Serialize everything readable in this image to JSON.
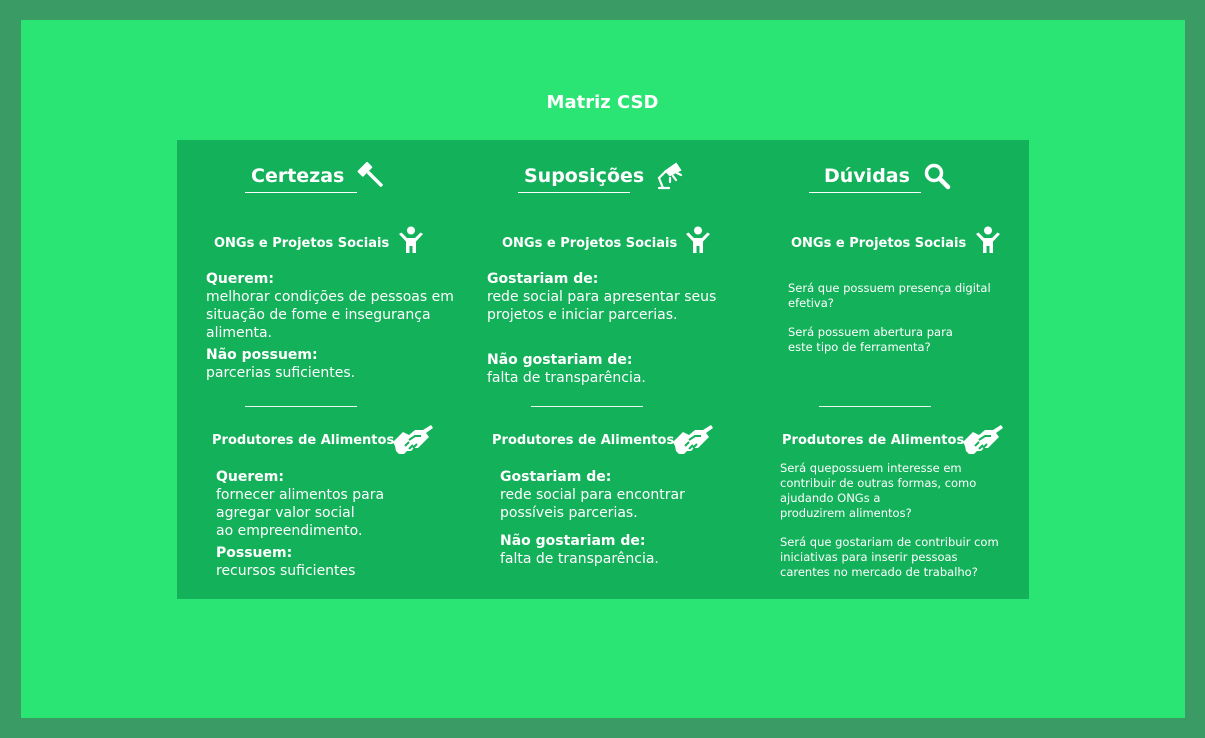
{
  "title": "Matriz CSD",
  "columns": {
    "certezas": {
      "heading": "Certezas",
      "icon": "gavel-icon",
      "ongs": {
        "heading": "ONGs e Projetos Sociais",
        "q1_label": "Querem:",
        "q1_lines": [
          "melhorar condições de pessoas em",
          "situação de fome e insegurança",
          "alimenta."
        ],
        "q2_label": "Não possuem:",
        "q2_lines": [
          "parcerias suficientes."
        ]
      },
      "produtores": {
        "heading": "Produtores de Alimentos",
        "q1_label": "Querem:",
        "q1_lines": [
          "fornecer alimentos para",
          "agregar valor social",
          "ao empreendimento."
        ],
        "q2_label": "Possuem:",
        "q2_lines": [
          "recursos suficientes"
        ]
      }
    },
    "suposicoes": {
      "heading": "Suposições",
      "icon": "desk-lamp-icon",
      "ongs": {
        "heading": "ONGs e Projetos Sociais",
        "q1_label": "Gostariam de:",
        "q1_lines": [
          "rede social para apresentar seus",
          "projetos e iniciar parcerias."
        ],
        "q2_label": "Não gostariam de:",
        "q2_lines": [
          "falta de transparência."
        ]
      },
      "produtores": {
        "heading": "Produtores de Alimentos",
        "q1_label": "Gostariam de:",
        "q1_lines": [
          "rede social para encontrar",
          "possíveis parcerias."
        ],
        "q2_label": "Não gostariam de:",
        "q2_lines": [
          "falta de transparência."
        ]
      }
    },
    "duvidas": {
      "heading": "Dúvidas",
      "icon": "search-icon",
      "ongs": {
        "heading": "ONGs e Projetos Sociais",
        "q1_lines": [
          "Será que possuem presença digital",
          "efetiva?"
        ],
        "q2_lines": [
          "Será possuem abertura para",
          "este tipo de ferramenta?"
        ]
      },
      "produtores": {
        "heading": "Produtores de Alimentos",
        "q1_lines": [
          "Será quepossuem interesse em",
          "contribuir de outras formas, como",
          "ajudando ONGs a",
          "produzirem alimentos?"
        ],
        "q2_lines": [
          "Será que gostariam de contribuir com",
          "iniciativas para inserir pessoas",
          "carentes no mercado de trabalho?"
        ]
      }
    }
  }
}
